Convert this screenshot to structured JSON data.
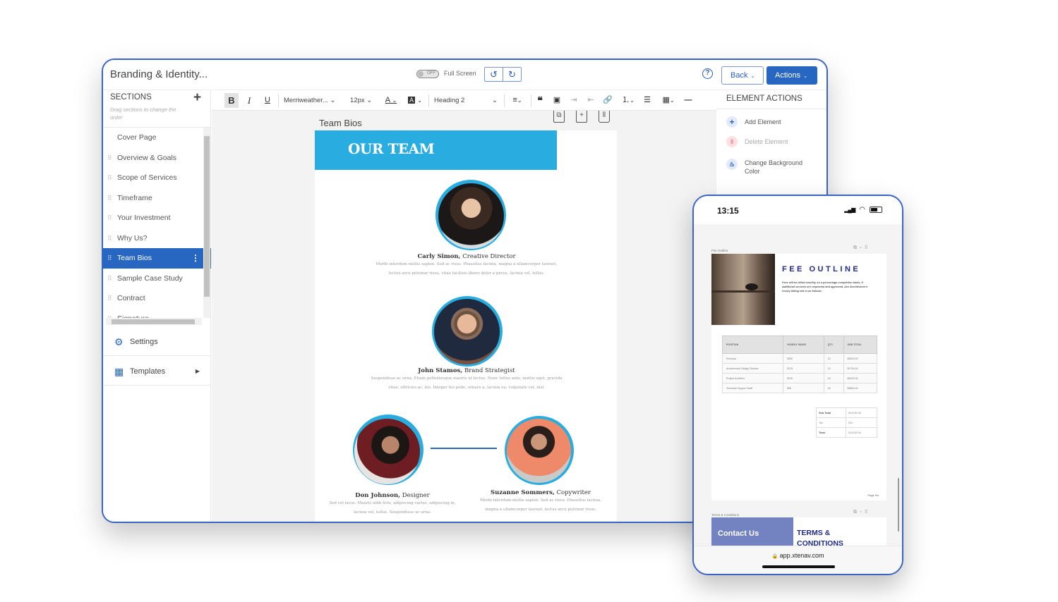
{
  "window": {
    "title": "Branding & Identity...",
    "fullscreen_toggle": "OFF",
    "fullscreen_label": "Full Screen",
    "undo_icon": "undo-icon",
    "redo_icon": "redo-icon",
    "help_icon": "?",
    "back_label": "Back",
    "actions_label": "Actions"
  },
  "sidebar": {
    "title": "SECTIONS",
    "add_icon": "+",
    "hint": "Drag sections to change the order",
    "items": [
      {
        "label": "Cover Page",
        "active": false
      },
      {
        "label": "Overview & Goals",
        "active": false
      },
      {
        "label": "Scope of Services",
        "active": false
      },
      {
        "label": "Timeframe",
        "active": false
      },
      {
        "label": "Your Investment",
        "active": false
      },
      {
        "label": "Why Us?",
        "active": false
      },
      {
        "label": "Team Bios",
        "active": true
      },
      {
        "label": "Sample Case Study",
        "active": false
      },
      {
        "label": "Contract",
        "active": false
      },
      {
        "label": "Signature",
        "active": false
      }
    ],
    "settings_label": "Settings",
    "templates_label": "Templates"
  },
  "toolbar": {
    "bold": "B",
    "italic": "I",
    "underline": "U",
    "font": "Merriweather...",
    "size": "12px",
    "text_color": "A",
    "bg_color": "A",
    "block": "Heading 2"
  },
  "canvas": {
    "section_name": "Team Bios",
    "banner_title": "OUR TEAM",
    "members": [
      {
        "name": "Carly Simon,",
        "role": "Creative Director",
        "bio": "Morbi interdum mollis sapien. Sed ac risus. Phasellus lacinia, magna a ullamcorper laoreet, lectus arcu pulvinar risus, vitae facilisis libero dolor a purus. lacinia vel, tellus."
      },
      {
        "name": "John Stamos,",
        "role": "Brand Strategist",
        "bio": "Suspendisse ac urna. Etiam pellentesque mauris ut lectus. Nunc tellus ante, mattis eget, gravida vitae, ultricies ac, leo. Integer leo pede, ornare a, lacinia eu, vulputate vel, nisl."
      },
      {
        "name": "Don Johnson,",
        "role": "Designer",
        "bio": "Sed vel lacus. Mauris nibh felis, adipiscing varius, adipiscing in, lacinia vel, tellus. Suspendisse ac urna."
      },
      {
        "name": "Suzanne Sommers,",
        "role": "Copywriter",
        "bio": "Morbi interdum mollis sapien. Sed ac risus. Phasellus lacinia, magna a ullamcorper laoreet, lectus arcu pulvinar risus."
      }
    ]
  },
  "element_actions": {
    "title": "ELEMENT ACTIONS",
    "items": [
      {
        "label": "Add Element",
        "icon": "+",
        "enabled": true
      },
      {
        "label": "Delete Element",
        "icon": "🗑",
        "enabled": false
      },
      {
        "label": "Change Background Color",
        "icon": "🖌",
        "enabled": true
      }
    ]
  },
  "phone": {
    "time": "13:15",
    "fee_section_label": "Fee Outline",
    "fee_title": "FEE OUTLINE",
    "fee_desc": "Fees will be billed monthly on a percentage completion basis. If additional services are requested and approved, Ace Architecture's hourly billing rate is as follows:",
    "table_headers": [
      "POSITION",
      "HOURLY WAGE",
      "QTY",
      "SUB TOTAL"
    ],
    "table_rows": [
      [
        "Principal",
        "$350",
        "10",
        "$3500.00"
      ],
      [
        "Architectural Design Director",
        "$175",
        "10",
        "$1750.00"
      ],
      [
        "Project Architect",
        "$130",
        "40",
        "$5200.00"
      ],
      [
        "Technical Support Staff",
        "$95",
        "40",
        "$3800.00"
      ]
    ],
    "summary": [
      [
        "Sub Total",
        "$14250.00"
      ],
      [
        "Tax",
        "$10"
      ],
      [
        "Total",
        "$14260.00"
      ]
    ],
    "page_no": "Page No.",
    "terms_section_label": "Terms & Conditions",
    "contact_label": "Contact Us",
    "terms_title_1": "TERMS &",
    "terms_title_2": "CONDITIONS",
    "url": "app.xtenav.com"
  }
}
